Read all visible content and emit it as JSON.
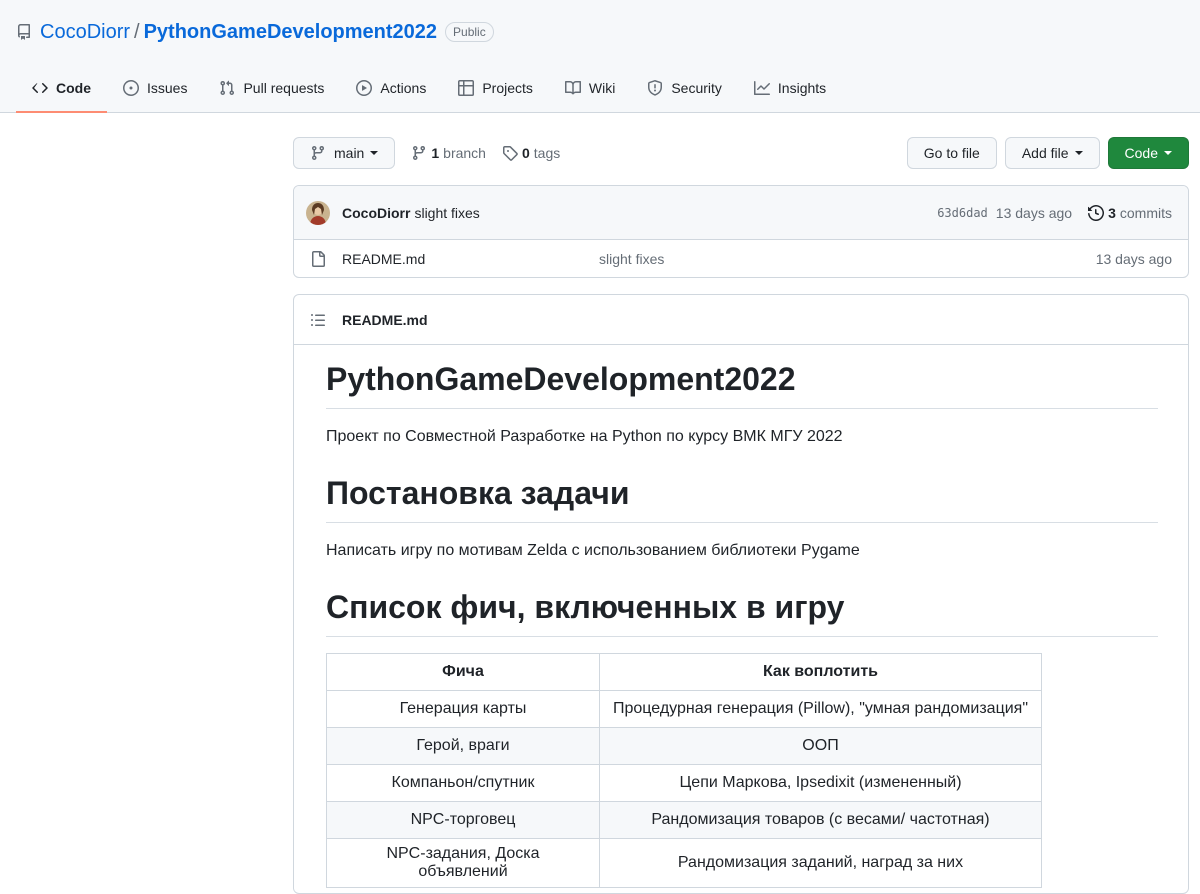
{
  "repo": {
    "owner": "CocoDiorr",
    "separator": "/",
    "name": "PythonGameDevelopment2022",
    "visibility": "Public"
  },
  "nav": [
    {
      "label": "Code",
      "icon": "code-icon",
      "active": true
    },
    {
      "label": "Issues",
      "icon": "issue-icon"
    },
    {
      "label": "Pull requests",
      "icon": "pull-request-icon"
    },
    {
      "label": "Actions",
      "icon": "play-icon"
    },
    {
      "label": "Projects",
      "icon": "table-icon"
    },
    {
      "label": "Wiki",
      "icon": "book-icon"
    },
    {
      "label": "Security",
      "icon": "shield-icon"
    },
    {
      "label": "Insights",
      "icon": "graph-icon"
    }
  ],
  "toolbar": {
    "branch": "main",
    "branch_count": "1",
    "branch_label": "branch",
    "tag_count": "0",
    "tag_label": "tags",
    "go_to_file": "Go to file",
    "add_file": "Add file",
    "code": "Code"
  },
  "commit": {
    "author": "CocoDiorr",
    "message": "slight fixes",
    "sha": "63d6dad",
    "age": "13 days ago",
    "commit_count": "3",
    "commit_label": "commits"
  },
  "files": [
    {
      "name": "README.md",
      "message": "slight fixes",
      "age": "13 days ago"
    }
  ],
  "readme": {
    "filename": "README.md",
    "title": "PythonGameDevelopment2022",
    "intro": "Проект по Совместной Разработке на Python по курсу ВМК МГУ 2022",
    "task_heading": "Постановка задачи",
    "task_text": "Написать игру по мотивам Zelda с использованием библиотеки Pygame",
    "features_heading": "Список фич, включенных в игру",
    "table": {
      "headers": [
        "Фича",
        "Как воплотить"
      ],
      "rows": [
        [
          "Генерация карты",
          "Процедурная генерация (Pillow), \"умная рандомизация\""
        ],
        [
          "Герой, враги",
          "ООП"
        ],
        [
          "Компаньон/спутник",
          "Цепи Маркова, Ipsedixit (измененный)"
        ],
        [
          "NPC-торговец",
          "Рандомизация товаров (с весами/ частотная)"
        ],
        [
          "NPC-задания, Доска объявлений",
          "Рандомизация заданий, наград за них"
        ]
      ]
    }
  },
  "colors": {
    "link": "#0969da",
    "active_tab_underline": "#fd8c73",
    "primary_button": "#1f883d",
    "header_bg": "#f6f8fa"
  }
}
